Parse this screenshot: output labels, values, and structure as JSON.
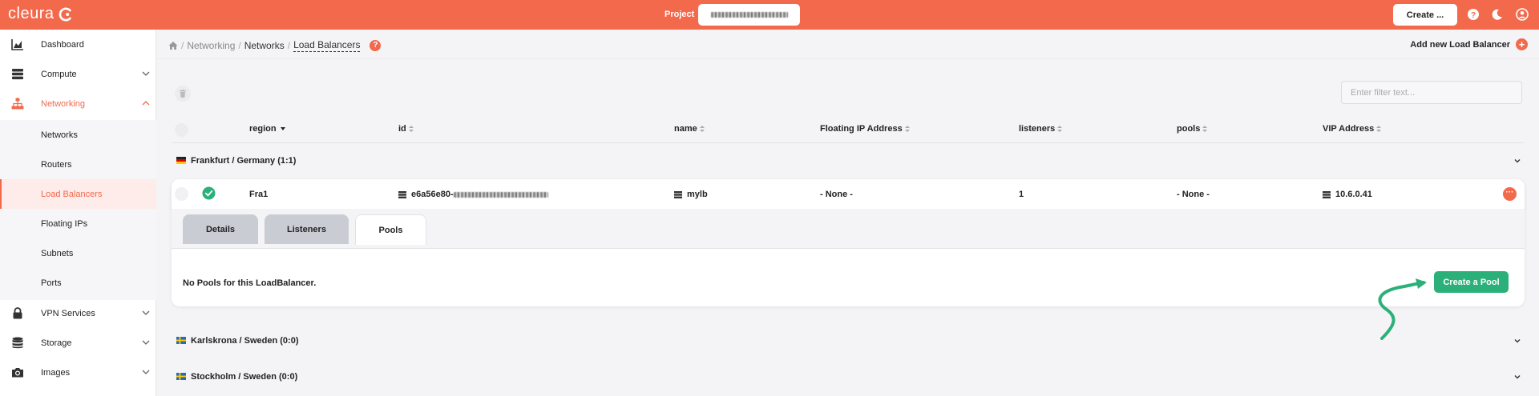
{
  "app": {
    "logo_text": "cleura",
    "project_label": "Project",
    "create_label": "Create ...",
    "accent_color": "#f2694c",
    "success_color": "#2cb07a"
  },
  "sidebar": {
    "items": [
      {
        "label": "Dashboard",
        "icon": "chart-icon"
      },
      {
        "label": "Compute",
        "icon": "server-stack-icon"
      },
      {
        "label": "Networking",
        "icon": "network-icon"
      },
      {
        "label": "VPN Services",
        "icon": "lock-icon"
      },
      {
        "label": "Storage",
        "icon": "database-icon"
      },
      {
        "label": "Images",
        "icon": "camera-icon"
      }
    ],
    "networking_sub": [
      "Networks",
      "Routers",
      "Load Balancers",
      "Floating IPs",
      "Subnets",
      "Ports"
    ]
  },
  "breadcrumb": {
    "items": [
      "Networking",
      "Networks",
      "Load Balancers"
    ]
  },
  "header": {
    "help_glyph": "?",
    "add_label": "Add new Load Balancer"
  },
  "filter": {
    "placeholder": "Enter filter text..."
  },
  "table": {
    "columns": [
      "region",
      "id",
      "name",
      "Floating IP Address",
      "listeners",
      "pools",
      "VIP Address"
    ]
  },
  "groups": [
    {
      "label": "Frankfurt / Germany (1:1)",
      "flag": "germany-flag"
    },
    {
      "label": "Karlskrona / Sweden (0:0)",
      "flag": "sweden-flag"
    },
    {
      "label": "Stockholm / Sweden (0:0)",
      "flag": "sweden-flag"
    }
  ],
  "loadbalancer": {
    "region": "Fra1",
    "id_prefix": "e6a56e80-",
    "name": "mylb",
    "floating_ip": "- None -",
    "listeners": "1",
    "pools": "- None -",
    "vip": "10.6.0.41",
    "more_glyph": "···"
  },
  "detail": {
    "tabs": [
      "Details",
      "Listeners",
      "Pools"
    ],
    "active_tab": "Pools",
    "empty_message": "No Pools for this LoadBalancer.",
    "create_pool_label": "Create a Pool"
  }
}
